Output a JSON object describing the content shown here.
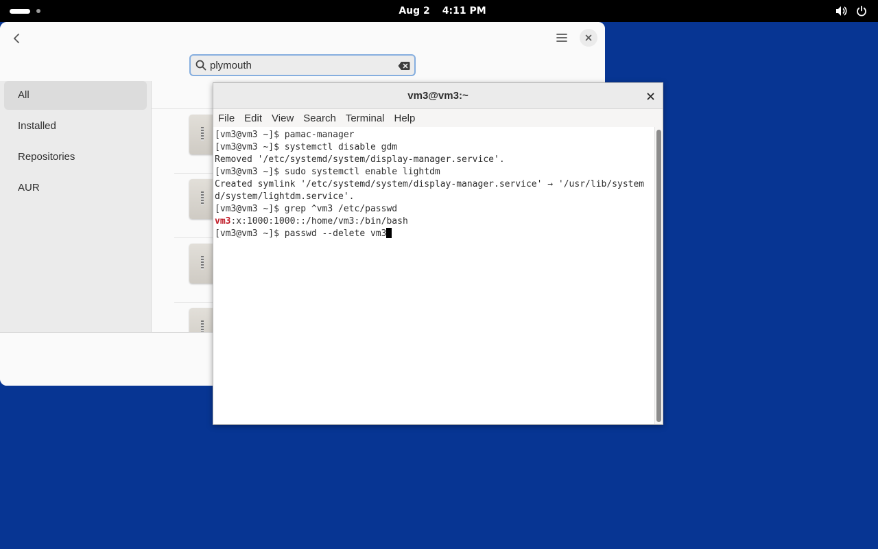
{
  "topbar": {
    "date": "Aug 2",
    "time": "4:11 PM",
    "icons": [
      "volume-icon",
      "power-icon"
    ]
  },
  "software": {
    "search": {
      "value": "plymouth"
    },
    "sidebar": {
      "items": [
        {
          "label": "All",
          "active": true
        },
        {
          "label": "Installed",
          "active": false
        },
        {
          "label": "Repositories",
          "active": false
        },
        {
          "label": "AUR",
          "active": false
        }
      ]
    }
  },
  "terminal": {
    "title": "vm3@vm3:~",
    "menu": [
      "File",
      "Edit",
      "View",
      "Search",
      "Terminal",
      "Help"
    ],
    "lines": [
      "[vm3@vm3 ~]$ pamac-manager",
      "[vm3@vm3 ~]$ systemctl disable gdm",
      "Removed '/etc/systemd/system/display-manager.service'.",
      "[vm3@vm3 ~]$ sudo systemctl enable lightdm",
      "Created symlink '/etc/systemd/system/display-manager.service' → '/usr/lib/system",
      "d/system/lightdm.service'.",
      "[vm3@vm3 ~]$ grep ^vm3 /etc/passwd"
    ],
    "grep_match": "vm3",
    "grep_rest": ":x:1000:1000::/home/vm3:/bin/bash",
    "current_prompt": "[vm3@vm3 ~]$ passwd --delete vm3"
  },
  "colors": {
    "desktop": "#073593",
    "match_highlight": "#c01c28"
  }
}
